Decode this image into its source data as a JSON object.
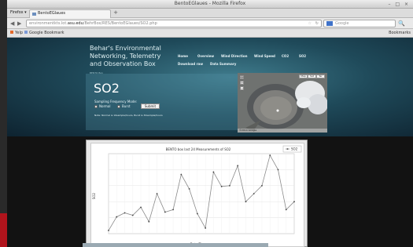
{
  "window": {
    "title": "BentoEGlaues - Mozilla Firefox",
    "controls": "– □ ×"
  },
  "tabs": {
    "firefox_menu": "Firefox ▾",
    "active_tab": "BentoEGlaues",
    "new_tab": "+"
  },
  "nav": {
    "back": "◀",
    "forward": "▶",
    "url_prefix": "environmentkts.lot.",
    "url_domain": "asu.edu",
    "url_suffix": "/BehrBox/RES/BentoEGlaues/SO2.php",
    "search_placeholder": "Google",
    "star": "☆",
    "reload": "↻",
    "search_go": "🔍"
  },
  "bookmarks": {
    "item1": "Yelp",
    "item2": "Google Bookmark",
    "right": "Bookmarks"
  },
  "site": {
    "headline_l1": "Behar's Environmental",
    "headline_l2": "Networking, Telemetry",
    "headline_l3": "and Observation Box",
    "headline_sub": "BENTO Box",
    "nav": [
      "Home",
      "Overview",
      "Wind Direction",
      "Wind Speed",
      "CO2",
      "SO2"
    ],
    "nav2": [
      "Download raw",
      "Data Summary"
    ],
    "page_title": "SO2",
    "sampling_label": "Sampling Frequency Mode:",
    "radio_normal": "Normal",
    "radio_burst": "Burst",
    "submit_label": "Submit",
    "note": "Note: Normal is 10sample/hours, Burst is 30sample/hours",
    "map_buttons": [
      "Map",
      "Sat",
      "Ter"
    ],
    "map_footer": "©2014 Google"
  },
  "chart_data": {
    "type": "line",
    "title": "BENTO box last 24 Measurements of SO2",
    "xlabel": "Date Time",
    "ylabel": "SO2",
    "legend": "SO2",
    "legend_position": "top-right",
    "grid": true,
    "values": [
      4,
      21,
      26,
      23,
      33,
      15,
      50,
      27,
      30,
      74,
      56,
      25,
      7,
      77,
      59,
      60,
      85,
      40,
      50,
      60,
      98,
      80,
      30,
      40
    ]
  },
  "colors": {
    "line": "#8a8a8a",
    "marker": "#444444",
    "brand_banner": "#1f4a5a"
  }
}
